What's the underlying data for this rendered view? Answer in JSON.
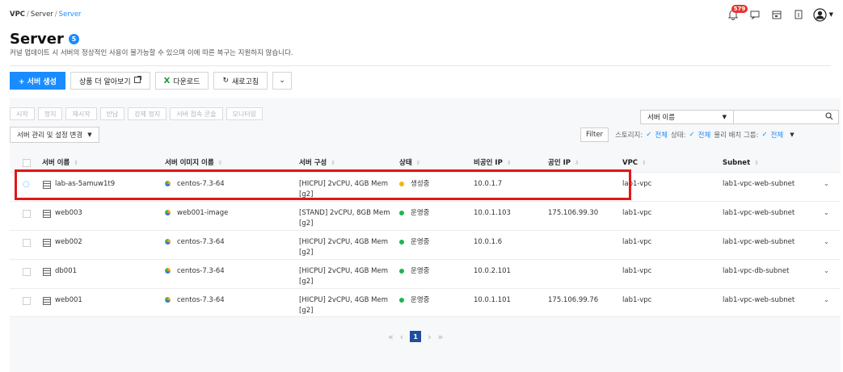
{
  "breadcrumb": {
    "items": [
      "VPC",
      "Server"
    ],
    "current": "Server"
  },
  "header": {
    "title": "Server",
    "count": "5",
    "subtitle": "커널 업데이트 시 서버의 정상적인 사용이 불가능할 수 있으며 이에 따른 복구는 지원하지 않습니다."
  },
  "top_icons": {
    "notification_count": "579"
  },
  "toolbar": {
    "create_label": "+ 서버 생성",
    "learn_more_label": "상품 더 알아보기",
    "download_label": "다운로드",
    "download_icon": "X",
    "refresh_label": "새로고침"
  },
  "actions": [
    "시작",
    "정지",
    "재시작",
    "반납",
    "강제 정지",
    "서버 접속 콘솔",
    "모니터링"
  ],
  "manage": {
    "label": "서버 관리 및 설정 변경"
  },
  "search": {
    "select_value": "서버 이름"
  },
  "filter": {
    "button_label": "Filter",
    "storage_label": "스토리지:",
    "storage_value": "전체",
    "status_label": "상태:",
    "status_value": "전체",
    "placement_label": "물리 배치 그룹:",
    "placement_value": "전체"
  },
  "table": {
    "columns": [
      "서버 이름",
      "서버 이미지 이름",
      "서버 구성",
      "상태",
      "비공인 IP",
      "공인 IP",
      "VPC",
      "Subnet"
    ],
    "rows": [
      {
        "name": "lab-as-5amuw1t9",
        "image": "centos-7.3-64",
        "spec": "[HICPU] 2vCPU, 4GB Mem",
        "spec2": "[g2]",
        "status": "생성중",
        "private_ip": "10.0.1.7",
        "public_ip": "",
        "vpc": "lab1-vpc",
        "subnet": "lab1-vpc-web-subnet"
      },
      {
        "name": "web003",
        "image": "web001-image",
        "spec": "[STAND] 2vCPU, 8GB Mem",
        "spec2": "[g2]",
        "status": "운영중",
        "private_ip": "10.0.1.103",
        "public_ip": "175.106.99.30",
        "vpc": "lab1-vpc",
        "subnet": "lab1-vpc-web-subnet"
      },
      {
        "name": "web002",
        "image": "centos-7.3-64",
        "spec": "[HICPU] 2vCPU, 4GB Mem",
        "spec2": "[g2]",
        "status": "운영중",
        "private_ip": "10.0.1.6",
        "public_ip": "",
        "vpc": "lab1-vpc",
        "subnet": "lab1-vpc-web-subnet"
      },
      {
        "name": "db001",
        "image": "centos-7.3-64",
        "spec": "[HICPU] 2vCPU, 4GB Mem",
        "spec2": "[g2]",
        "status": "운영중",
        "private_ip": "10.0.2.101",
        "public_ip": "",
        "vpc": "lab1-vpc",
        "subnet": "lab1-vpc-db-subnet"
      },
      {
        "name": "web001",
        "image": "centos-7.3-64",
        "spec": "[HICPU] 2vCPU, 4GB Mem",
        "spec2": "[g2]",
        "status": "운영중",
        "private_ip": "10.0.1.101",
        "public_ip": "175.106.99.76",
        "vpc": "lab1-vpc",
        "subnet": "lab1-vpc-web-subnet"
      }
    ]
  },
  "pagination": {
    "current": "1"
  },
  "colors": {
    "accent": "#1a8cff",
    "running": "#1fb356",
    "creating": "#f5b700",
    "highlight": "#e0161a"
  }
}
